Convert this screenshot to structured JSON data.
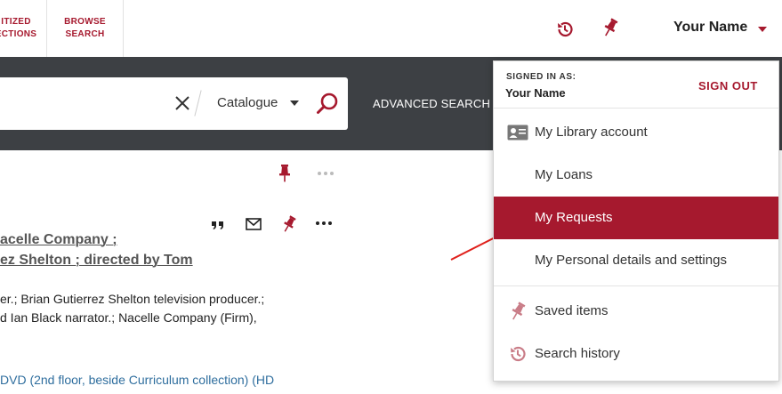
{
  "header": {
    "nav_tabs": [
      {
        "line1": "ITIZED",
        "line2": "ECTIONS"
      },
      {
        "line1": "BROWSE",
        "line2": "SEARCH"
      }
    ],
    "user_name": "Your Name"
  },
  "search": {
    "scope": "Catalogue",
    "advanced_label": "ADVANCED SEARCH"
  },
  "result": {
    "title_lines": [
      "acelle Company ;",
      "ez Shelton ; directed by Tom"
    ],
    "body_lines": [
      "er.; Brian Gutierrez Shelton television producer.;",
      "d Ian Black narrator.; Nacelle Company (Firm),"
    ],
    "availability": "DVD (2nd floor, beside Curriculum collection) (HD"
  },
  "dropdown": {
    "signed_in_label": "SIGNED IN AS:",
    "signed_in_name": "Your Name",
    "sign_out_label": "SIGN OUT",
    "items": [
      {
        "label": "My Library account",
        "icon": "id-card-icon"
      },
      {
        "label": "My Loans",
        "icon": ""
      },
      {
        "label": "My Requests",
        "icon": ""
      },
      {
        "label": "My Personal details and settings",
        "icon": ""
      },
      {
        "label": "Saved items",
        "icon": "pin-icon"
      },
      {
        "label": "Search history",
        "icon": "history-icon"
      }
    ]
  },
  "colors": {
    "brand": "#a6192e",
    "search_band": "#3d4044",
    "link_blue": "#2f6e9e"
  }
}
